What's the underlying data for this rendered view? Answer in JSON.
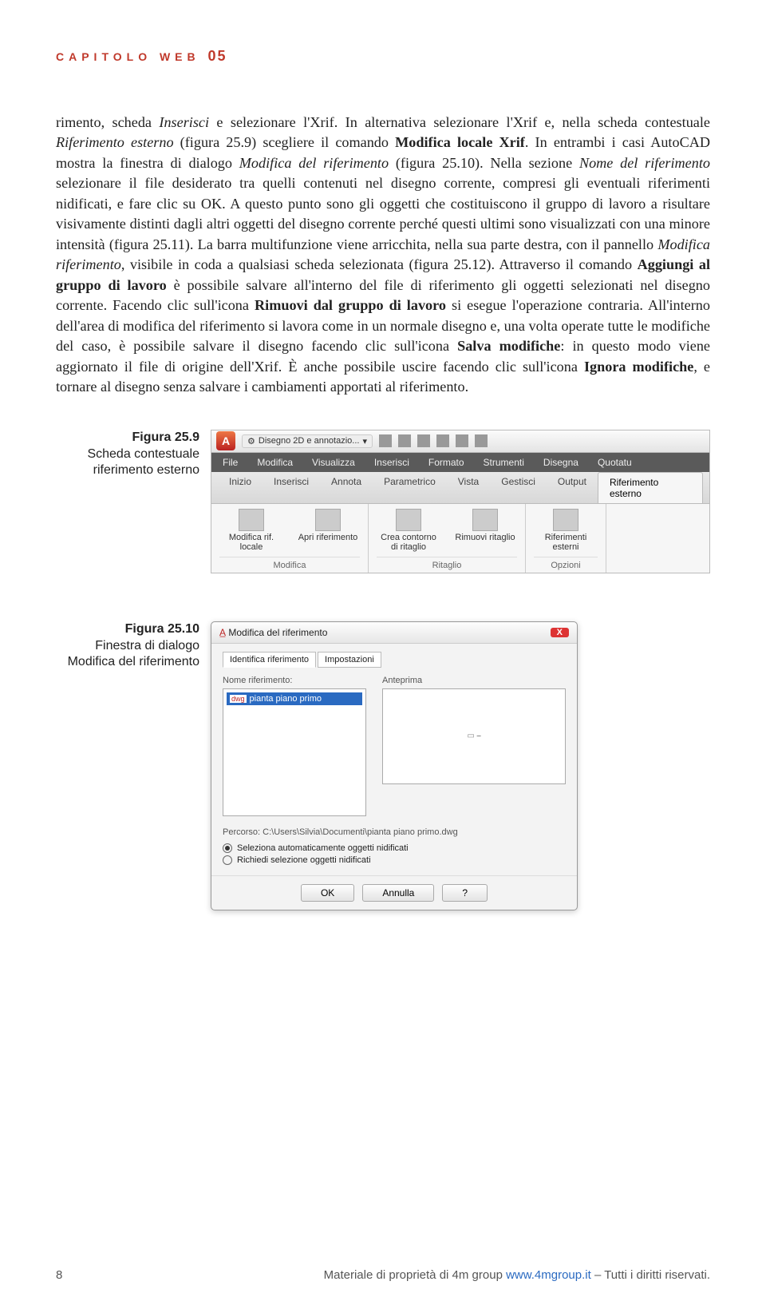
{
  "header": {
    "label": "CAPITOLO WEB",
    "num": "05"
  },
  "body_html": "rimento, scheda <i>Inserisci</i> e selezionare l'Xrif. In alternativa selezionare l'Xrif e, nella scheda contestuale <i>Riferimento esterno</i> (figura 25.9) scegliere il comando <b>Modifica locale Xrif</b>. In entrambi i casi AutoCAD mostra la finestra di dialogo <i>Modifica del riferimento</i> (figura 25.10). Nella sezione <i>Nome del riferimento</i> selezionare il file desiderato tra quelli contenuti nel disegno corrente, compresi gli eventuali riferimenti nidificati, e fare clic su OK. A questo punto sono gli oggetti che costituiscono il gruppo di lavoro a risultare visivamente distinti dagli altri oggetti del disegno corrente perché questi ultimi sono visualizzati con una minore intensità (figura 25.11). La barra multifunzione viene arricchita, nella sua parte destra, con il pannello <i>Modifica riferimento</i>, visibile in coda a qualsiasi scheda selezionata (figura 25.12). Attraverso il comando <b>Aggiungi al gruppo di lavoro</b> è possibile salvare all'interno del file di riferimento gli oggetti selezionati nel disegno corrente. Facendo clic sull'icona <b>Rimuovi dal gruppo di lavoro</b> si esegue l'operazione contraria. All'interno dell'area di modifica del riferimento si lavora come in un normale disegno e, una volta operate tutte le modifiche del caso, è possibile salvare il disegno facendo clic sull'icona <b>Salva modifiche</b>: in questo modo viene aggiornato il file di origine dell'Xrif. È anche possibile uscire facendo clic sull'icona <b>Ignora modifiche</b>, e tornare al disegno senza salvare i cambiamenti apportati al riferimento.",
  "fig9": {
    "caption_title": "Figura 25.9",
    "caption_text": "Scheda contestuale riferimento esterno",
    "qat_workspace": "Disegno 2D e annotazio...",
    "menubar": [
      "File",
      "Modifica",
      "Visualizza",
      "Inserisci",
      "Formato",
      "Strumenti",
      "Disegna",
      "Quotatu"
    ],
    "tabs": [
      "Inizio",
      "Inserisci",
      "Annota",
      "Parametrico",
      "Vista",
      "Gestisci",
      "Output",
      "Riferimento esterno"
    ],
    "active_tab_index": 7,
    "panels": [
      {
        "title": "Modifica",
        "buttons": [
          "Modifica rif. locale",
          "Apri riferimento"
        ]
      },
      {
        "title": "Ritaglio",
        "buttons": [
          "Crea contorno di ritaglio",
          "Rimuovi ritaglio"
        ]
      },
      {
        "title": "Opzioni",
        "buttons": [
          "Riferimenti esterni"
        ]
      }
    ]
  },
  "fig10": {
    "caption_title": "Figura 25.10",
    "caption_text": "Finestra di dialogo Modifica del riferimento",
    "dialog_title": "Modifica del riferimento",
    "tabs": [
      "Identifica riferimento",
      "Impostazioni"
    ],
    "label_name": "Nome riferimento:",
    "selected_item": "pianta piano primo",
    "label_preview": "Anteprima",
    "path_label": "Percorso:",
    "path_value": "C:\\Users\\Silvia\\Documenti\\pianta piano primo.dwg",
    "radio1": "Seleziona automaticamente oggetti nidificati",
    "radio2": "Richiedi selezione oggetti nidificati",
    "btn_ok": "OK",
    "btn_cancel": "Annulla",
    "btn_help": "?"
  },
  "footer": {
    "page": "8",
    "text_pre": "Materiale di proprietà di 4m group ",
    "link": "www.4mgroup.it",
    "text_post": " – Tutti i diritti riservati."
  }
}
